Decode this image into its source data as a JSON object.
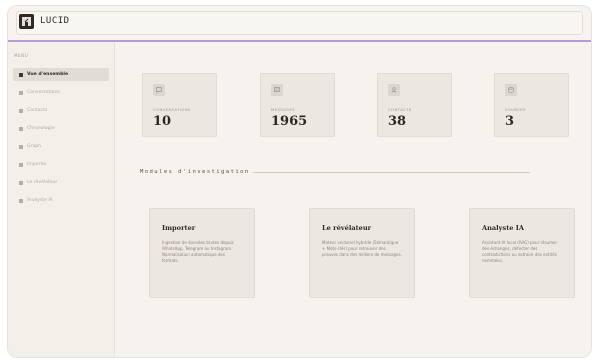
{
  "app": {
    "brand": "LUCID"
  },
  "sidebar": {
    "section": "MENU",
    "items": [
      {
        "label": "Vue d'ensemble",
        "active": true
      },
      {
        "label": "Conversations"
      },
      {
        "label": "Contacts"
      },
      {
        "label": "Chronologie"
      },
      {
        "label": "Graph"
      },
      {
        "label": "Importer"
      },
      {
        "label": "Le révélateur"
      },
      {
        "label": "Analyste IA"
      }
    ]
  },
  "stats": [
    {
      "label": "CONVERSATIONS",
      "value": "10",
      "icon": "chat-icon"
    },
    {
      "label": "MESSAGES",
      "value": "1965",
      "icon": "message-icon"
    },
    {
      "label": "CONTACTS",
      "value": "38",
      "icon": "contacts-icon"
    },
    {
      "label": "SOURCES",
      "value": "3",
      "icon": "source-icon"
    }
  ],
  "modules": {
    "title": "Modules d'investigation",
    "items": [
      {
        "title": "Importer",
        "desc": "Ingestion de données brutes depuis WhatsApp, Telegram ou Instagram. Normalisation automatique des formats."
      },
      {
        "title": "Le révélateur",
        "desc": "Moteur vectoriel hybride (Sémantique + Mots-clés) pour retrouver des preuves dans des milliers de messages."
      },
      {
        "title": "Analyste IA",
        "desc": "Assistant IA local (RAG) pour résumer des échanges, détecter des contradictions ou extraire des entités nommées."
      }
    ]
  },
  "colors": {
    "accent": "#b79bd9",
    "background": "#f6f3ee",
    "card": "#ece8e1"
  }
}
